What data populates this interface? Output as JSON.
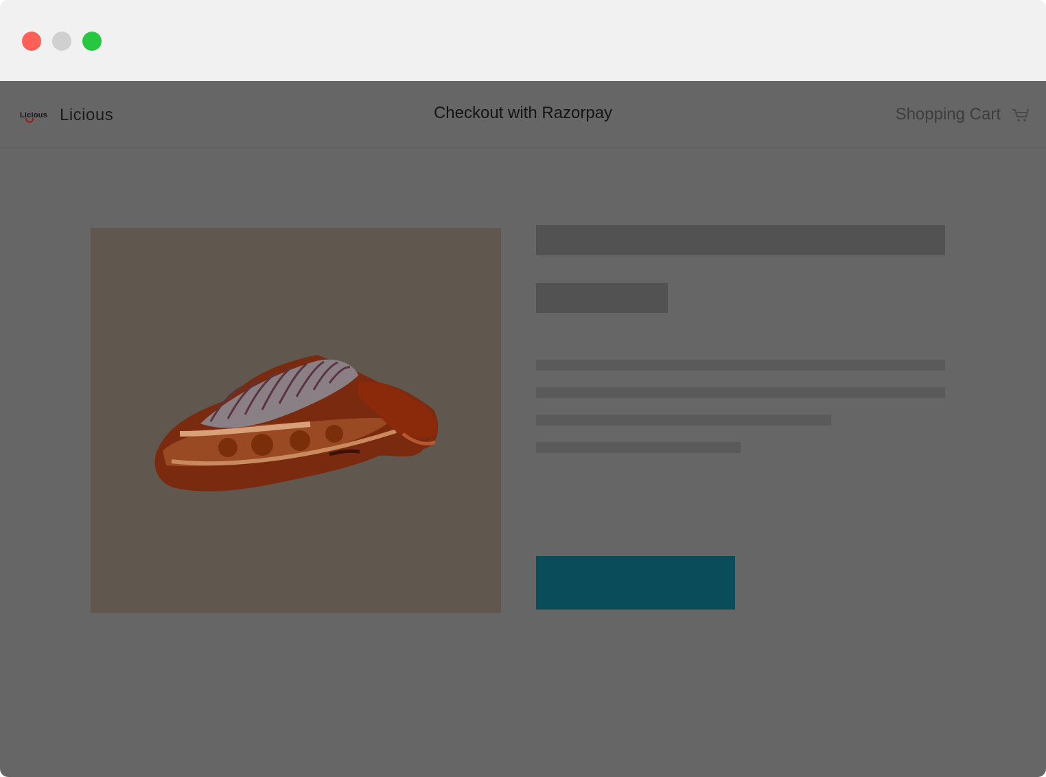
{
  "window": {
    "controls": [
      "close",
      "minimize",
      "maximize"
    ]
  },
  "nav": {
    "logo_text": "Licious",
    "brand_name": "Licious",
    "title": "Checkout with Razorpay",
    "cart_label": "Shopping Cart",
    "cart_icon": "shopping-cart-icon"
  },
  "product": {
    "image_icon": "meat-ribs-image",
    "buy_button_label": ""
  },
  "colors": {
    "overlay": "#666666",
    "button": "#0b4c5a",
    "close": "#fe5f57",
    "minimize": "#d0d0d0",
    "maximize": "#27c840"
  }
}
